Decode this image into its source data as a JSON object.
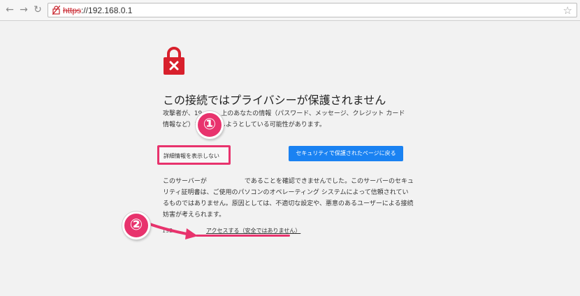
{
  "browser": {
    "back_icon": "arrow-left-icon",
    "forward_icon": "arrow-right-icon",
    "reload_icon": "reload-icon",
    "url_scheme": "https",
    "url_rest": "://192.168.0.1",
    "bookmark_icon": "star-icon",
    "insecure_color": "#c8232c"
  },
  "warning": {
    "icon": "padlock-x-icon",
    "icon_color": "#d8202c",
    "title": "この接続ではプライバシーが保護されません",
    "paragraph1": [
      "攻撃者が、19　　　上のあなたの情報（パスワード、メッセージ、クレジット カード",
      "情報など）を　　　しようとしている可能性があります。"
    ],
    "details_button": "詳細情報を表示しない",
    "back_button": "セキュリティで保護されたページに戻る",
    "paragraph2": [
      "このサーバーが　　　　　　であることを確認できませんでした。このサーバーのセキュ",
      "リティ証明書は、ご使用のパソコンのオペレーティング システムによって信頼されてい",
      "るものではありません。原因としては、不適切な設定や、悪意のあるユーザーによる接続",
      "妨害が考えられます。"
    ],
    "proceed_lead": "192.",
    "proceed_link": "アクセスする（安全ではありません）"
  },
  "annotations": {
    "badge1": "①",
    "badge2": "②",
    "highlight_color": "#e8336d"
  }
}
